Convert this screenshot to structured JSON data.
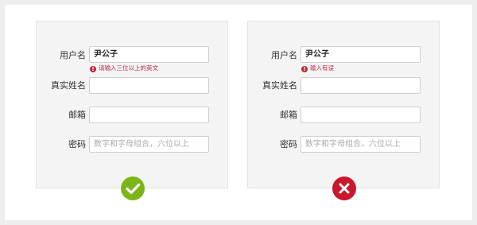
{
  "valid_form": {
    "fields": [
      {
        "label": "用户名",
        "value": "尹公子"
      },
      {
        "label": "真实姓名",
        "value": ""
      },
      {
        "label": "邮箱",
        "value": ""
      },
      {
        "label": "密码",
        "placeholder": "数字和字母组合，六位以上"
      }
    ],
    "error_text": "请输入三位以上的英文",
    "error_icon": "!",
    "status_icon": "check-icon",
    "status_color": "#7cb518"
  },
  "invalid_form": {
    "fields": [
      {
        "label": "用户名",
        "value": "尹公子"
      },
      {
        "label": "真实姓名",
        "value": ""
      },
      {
        "label": "邮箱",
        "value": ""
      },
      {
        "label": "密码",
        "placeholder": "数字和字母组合，六位以上"
      }
    ],
    "error_text": "输入有误",
    "error_icon": "!",
    "status_icon": "cross-icon",
    "status_color": "#c8182e"
  },
  "colors": {
    "error": "#c0283a",
    "panel_bg": "#f4f4f4"
  }
}
